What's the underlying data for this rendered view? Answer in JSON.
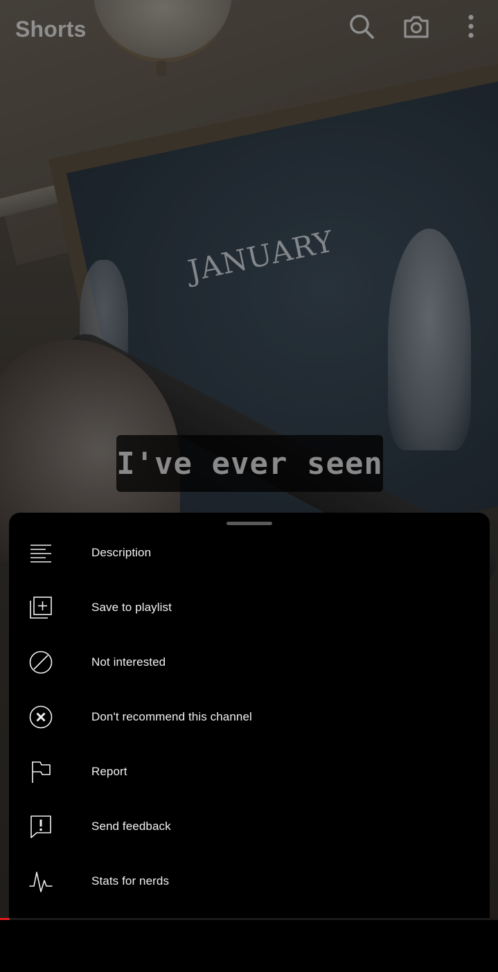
{
  "app": {
    "title": "Shorts"
  },
  "video": {
    "caption": "I've ever seen",
    "board_text": "JANUARY",
    "progress_fraction": 0.02
  },
  "toolbar": {
    "icons": [
      "search-icon",
      "camera-icon",
      "more-vert-icon"
    ]
  },
  "sheet": {
    "items": [
      {
        "label": "Description",
        "icon": "description-icon"
      },
      {
        "label": "Save to playlist",
        "icon": "playlist-add-icon"
      },
      {
        "label": "Not interested",
        "icon": "not-interested-icon"
      },
      {
        "label": "Don't recommend this channel",
        "icon": "block-channel-icon"
      },
      {
        "label": "Report",
        "icon": "flag-icon"
      },
      {
        "label": "Send feedback",
        "icon": "feedback-icon"
      },
      {
        "label": "Stats for nerds",
        "icon": "stats-icon"
      }
    ]
  },
  "colors": {
    "sheet_bg": "#000000",
    "text": "#f1f1f1",
    "brand_red": "#e31b1b"
  }
}
